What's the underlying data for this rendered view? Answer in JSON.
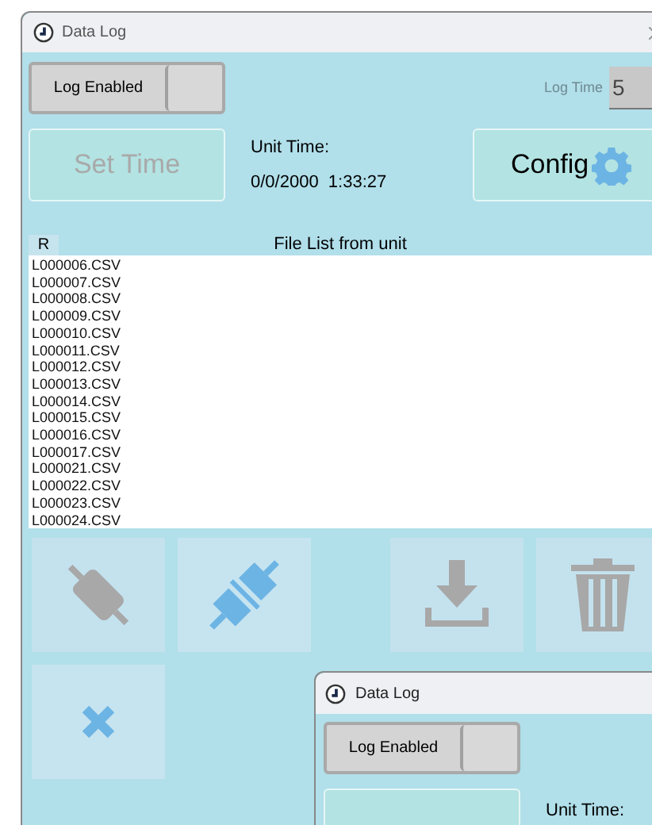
{
  "window": {
    "title": "Data Log"
  },
  "log_toggle": {
    "label": "Log Enabled",
    "on": false
  },
  "log_time": {
    "label": "Log Time",
    "value": "5",
    "disabled": true
  },
  "set_time_button": {
    "label": "Set Time",
    "disabled": true
  },
  "unit_time": {
    "label": "Unit Time:",
    "value": "0/0/2000  1:33:27"
  },
  "config_button": {
    "label": "Config"
  },
  "file_list": {
    "refresh_button": "R",
    "title": "File List from unit",
    "files": [
      "L000006.CSV",
      "L000007.CSV",
      "L000008.CSV",
      "L000009.CSV",
      "L000010.CSV",
      "L000011.CSV",
      "L000012.CSV",
      "L000013.CSV",
      "L000014.CSV",
      "L000015.CSV",
      "L000016.CSV",
      "L000017.CSV",
      "L000021.CSV",
      "L000022.CSV",
      "L000023.CSV",
      "L000024.CSV"
    ]
  },
  "actions": [
    {
      "kind": "disconnect",
      "disabled": true
    },
    {
      "kind": "connect",
      "disabled": false
    },
    {
      "kind": "download",
      "disabled": true
    },
    {
      "kind": "delete",
      "disabled": true
    },
    {
      "kind": "cancel",
      "disabled": false
    }
  ],
  "second_window": {
    "title": "Data Log",
    "log_toggle": {
      "label": "Log Enabled",
      "on": false
    },
    "unit_time_label": "Unit Time:"
  }
}
